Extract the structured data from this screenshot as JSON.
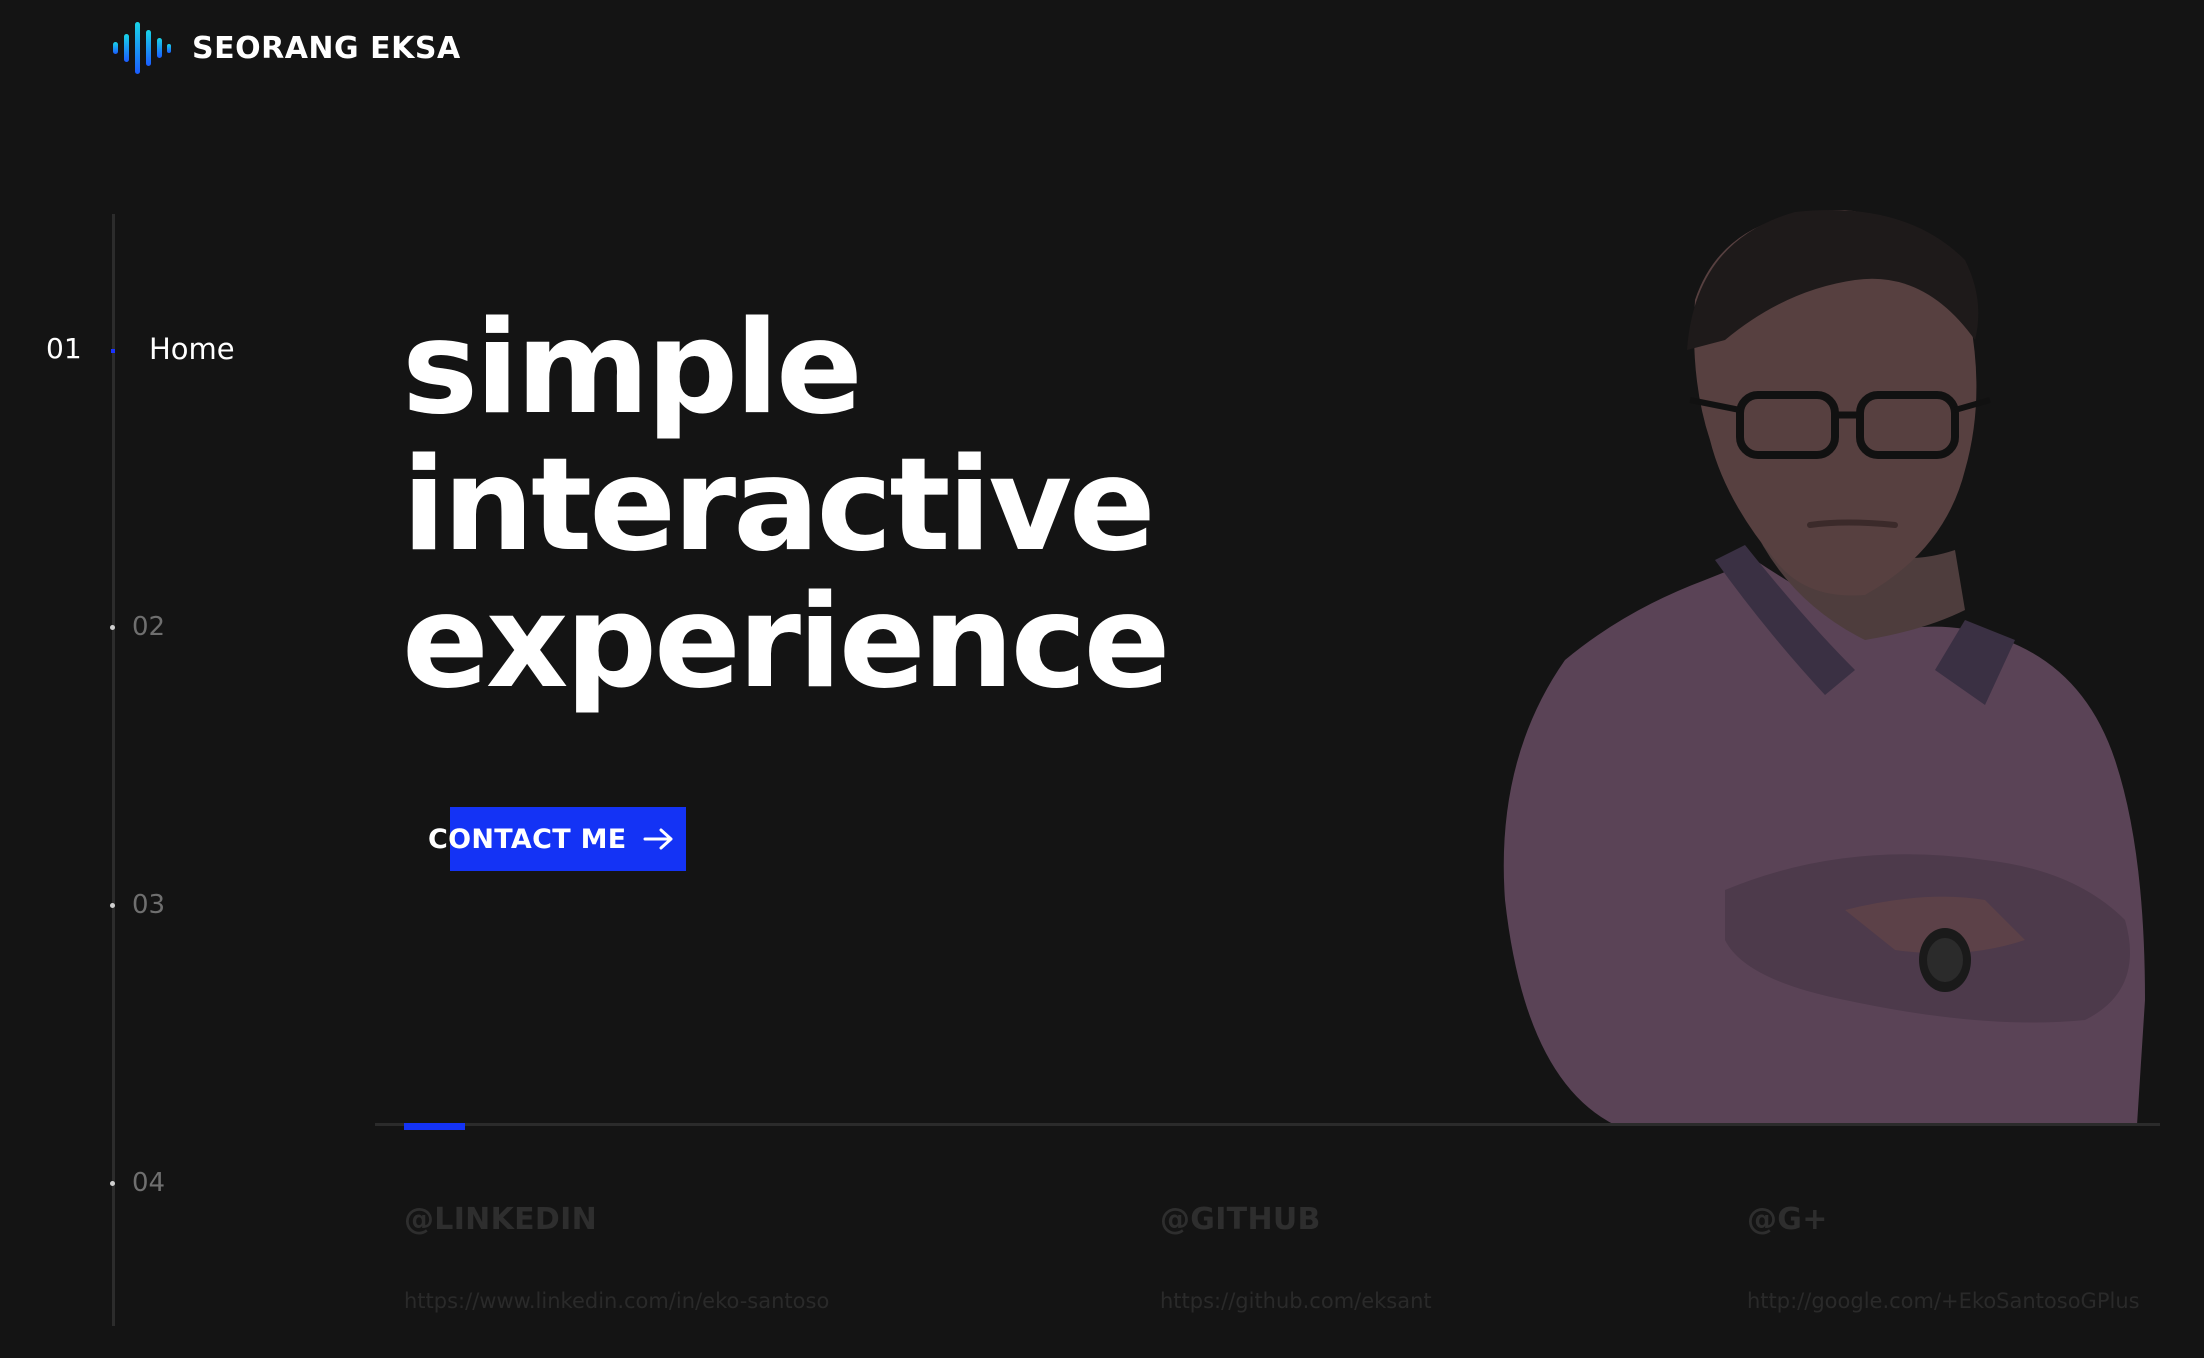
{
  "brand": {
    "name": "SEORANG EKSA",
    "logo_icon": "sound-wave-icon",
    "colors": {
      "cyan": "#19c6e0",
      "blue": "#1a5cff"
    }
  },
  "nav": {
    "active": {
      "number": "01",
      "label": "Home"
    },
    "items": [
      {
        "number": "02"
      },
      {
        "number": "03"
      },
      {
        "number": "04"
      }
    ]
  },
  "hero": {
    "lines": [
      "simple",
      "interactive",
      "experience"
    ]
  },
  "cta": {
    "label": "CONTACT ME",
    "icon": "arrow-right-icon",
    "color": "#1433f5"
  },
  "social": [
    {
      "title": "@LINKEDIN",
      "url": "https://www.linkedin.com/in/eko-santoso"
    },
    {
      "title": "@GITHUB",
      "url": "https://github.com/eksant"
    },
    {
      "title": "@G+",
      "url": "http://google.com/+EkoSantosoGPlus"
    }
  ],
  "colors": {
    "background": "#141414",
    "accent": "#1433f5"
  }
}
